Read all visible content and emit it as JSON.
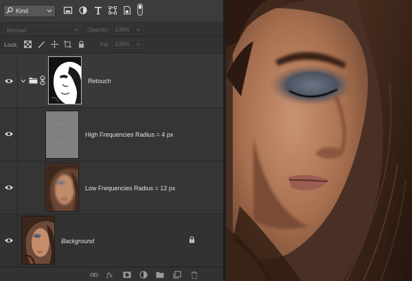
{
  "filter": {
    "kind_label": "Kind",
    "filter_icons": [
      "image-filter-icon",
      "adjustment-filter-icon",
      "type-filter-icon",
      "shape-filter-icon",
      "smart-object-filter-icon"
    ],
    "toggle_icon": "filter-toggle-icon"
  },
  "blend": {
    "mode": "Normal",
    "opacity_label": "Opacity:",
    "opacity_value": "100%"
  },
  "lock": {
    "label": "Lock:",
    "icons": [
      "lock-transparent-pixels-icon",
      "lock-image-pixels-icon",
      "lock-position-icon",
      "lock-artboard-icon",
      "lock-all-icon"
    ],
    "fill_label": "Fill:",
    "fill_value": "100%"
  },
  "layers": [
    {
      "name": "Retouch",
      "type": "group",
      "visible": true
    },
    {
      "name": "High Frequencies Radius = 4 px",
      "type": "pixel",
      "visible": true
    },
    {
      "name": "Low Frequencies Radius = 12 px",
      "type": "pixel",
      "visible": true
    },
    {
      "name": "Background",
      "type": "background",
      "visible": true,
      "locked": true
    }
  ],
  "toolbar": {
    "icons": [
      "link-layers-icon",
      "layer-style-icon",
      "add-mask-icon",
      "new-adjustment-icon",
      "new-group-icon",
      "new-layer-icon",
      "delete-layer-icon"
    ]
  },
  "colors": {
    "panel_bg": "#323232",
    "selected_layer_bg": "#393939",
    "text": "#e2e2e2",
    "skin": "#b07a5a",
    "hair": "#3a2418"
  }
}
